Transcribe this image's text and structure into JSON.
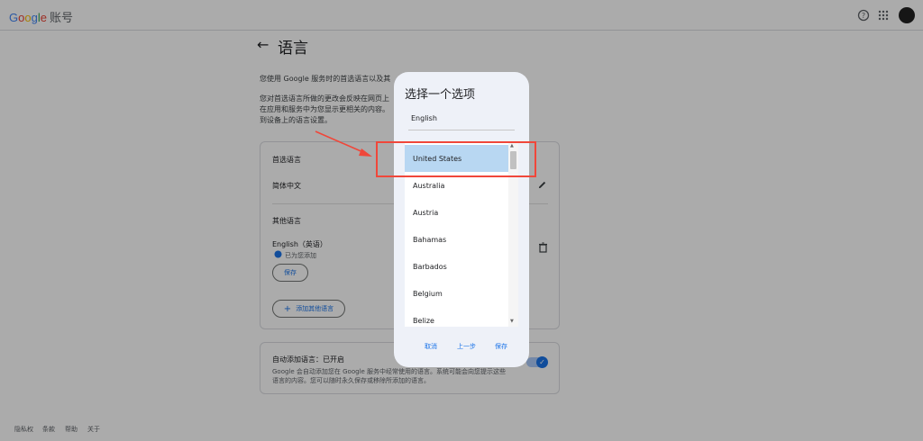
{
  "header": {
    "logo_text": "Google",
    "account_text": "账号",
    "icons": [
      "help-icon",
      "apps-grid-icon",
      "avatar"
    ]
  },
  "page": {
    "title": "语言",
    "intro_lines": [
      "您使用 Google 服务时的首选语言以及其",
      "您对首选语言所做的更改会反映在网页上",
      "在应用和服务中为您显示更相关的内容。",
      "到设备上的语言设置。"
    ]
  },
  "preferred_card": {
    "heading": "首选语言",
    "preferred_language": "简体中文",
    "other_heading": "其他语言",
    "other_language": "English（英语）",
    "added_note": "已为您添加",
    "save_label": "保存",
    "add_other_label": "添加其他语言"
  },
  "auto_card": {
    "title": "自动添加语言：已开启",
    "description_line1": "Google 会自动添加您在 Google 服务中经常使用的语言。系统可能会向您提示这些",
    "description_line2": "语言的内容。您可以随时永久保存或移除所添加的语言。"
  },
  "footer": {
    "links": [
      "隐私权",
      "条款",
      "帮助",
      "关于"
    ]
  },
  "dialog": {
    "title": "选择一个选项",
    "selected_value": "English",
    "options": [
      "United States",
      "Australia",
      "Austria",
      "Bahamas",
      "Barbados",
      "Belgium",
      "Belize"
    ],
    "highlighted_option": "United States",
    "cancel_label": "取消",
    "back_label": "上一步",
    "save_label": "保存"
  },
  "colors": {
    "accent": "#1a73e8",
    "highlight": "#b8d7f2",
    "annotation_red": "#f0473a"
  }
}
